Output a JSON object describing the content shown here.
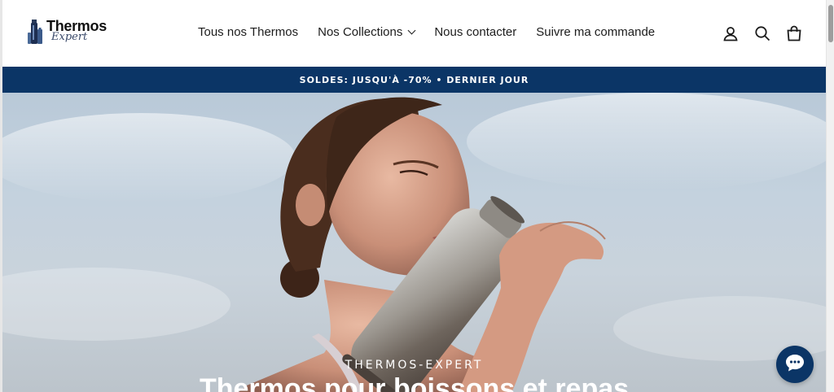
{
  "brand": {
    "word": "Thermos",
    "script": "Expert"
  },
  "nav": {
    "items": [
      {
        "label": "Tous nos Thermos"
      },
      {
        "label": "Nos Collections",
        "has_dropdown": true
      },
      {
        "label": "Nous contacter"
      },
      {
        "label": "Suivre ma commande"
      }
    ]
  },
  "header_icons": [
    "account-icon",
    "search-icon",
    "cart-icon"
  ],
  "announcement": {
    "text": "SOLDES: JUSQU'À -70% • DERNIER JOUR"
  },
  "hero": {
    "kicker": "THERMOS-EXPERT",
    "title": "Thermos pour boissons et repas"
  },
  "colors": {
    "accent": "#0b3566",
    "text": "#1c1c1c",
    "announce_text": "#ffffff"
  },
  "chat": {
    "icon": "chat-bubble-icon"
  }
}
